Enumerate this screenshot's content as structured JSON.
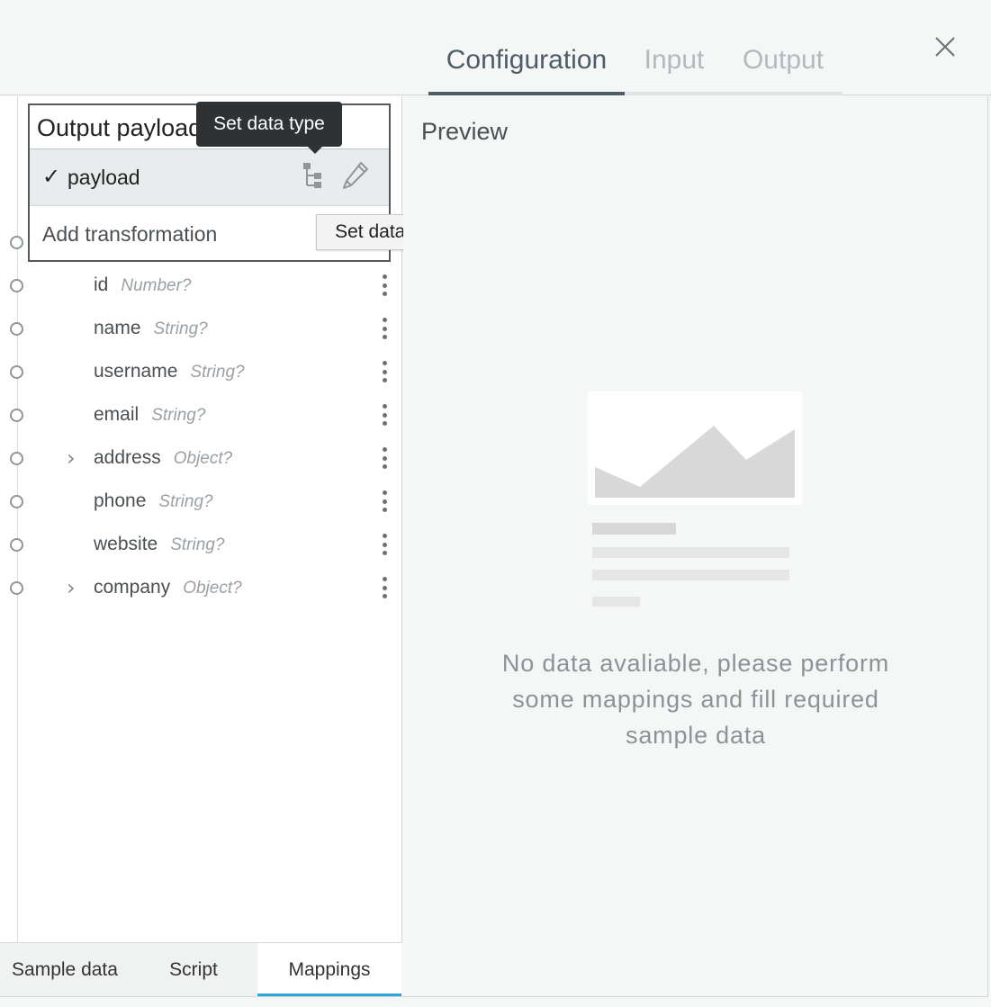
{
  "header": {
    "tabs": [
      {
        "label": "Configuration",
        "active": true
      },
      {
        "label": "Input",
        "active": false
      },
      {
        "label": "Output",
        "active": false
      }
    ]
  },
  "left": {
    "dropdown": {
      "title": "Output payload",
      "selected_item": "payload",
      "check": "✓",
      "add_label": "Add transformation"
    },
    "tooltips": {
      "dark": "Set data type",
      "light": "Set data type"
    },
    "fields": [
      {
        "name": "id",
        "type": "Number?",
        "expandable": false
      },
      {
        "name": "name",
        "type": "String?",
        "expandable": false
      },
      {
        "name": "username",
        "type": "String?",
        "expandable": false
      },
      {
        "name": "email",
        "type": "String?",
        "expandable": false
      },
      {
        "name": "address",
        "type": "Object?",
        "expandable": true
      },
      {
        "name": "phone",
        "type": "String?",
        "expandable": false
      },
      {
        "name": "website",
        "type": "String?",
        "expandable": false
      },
      {
        "name": "company",
        "type": "Object?",
        "expandable": true
      }
    ],
    "bottom_tabs": [
      {
        "label": "Sample data",
        "active": false
      },
      {
        "label": "Script",
        "active": false
      },
      {
        "label": "Mappings",
        "active": true
      }
    ]
  },
  "right": {
    "title": "Preview",
    "empty_message": "No data avaliable, please perform some mappings and fill required sample data"
  },
  "colors": {
    "active_tab": "#4d5c66",
    "accent": "#2fa4d6"
  }
}
